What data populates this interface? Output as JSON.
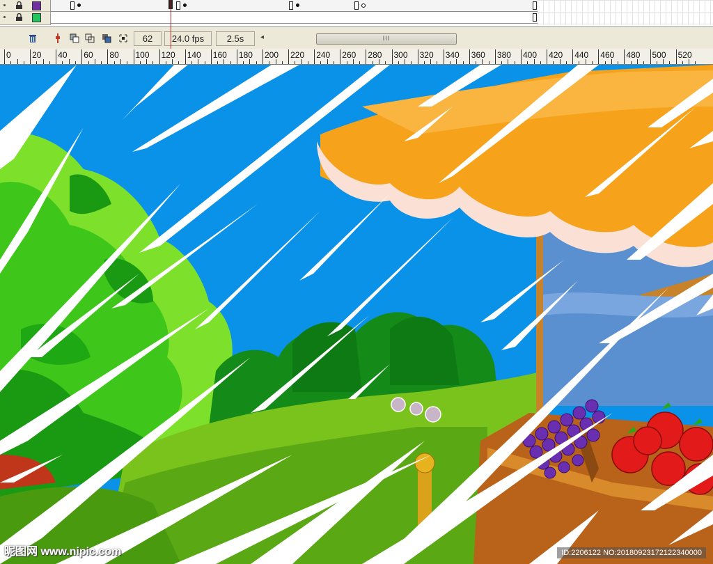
{
  "timeline": {
    "layers": [
      {
        "visibility_icon": "eye-dot-icon",
        "lock_icon": "lock-icon",
        "outline_color": "#7030a0"
      },
      {
        "visibility_icon": "eye-dot-icon",
        "lock_icon": "lock-icon",
        "outline_color": "#22c55e"
      }
    ]
  },
  "statusbar": {
    "icons": [
      "center-frame-icon",
      "onion-skin-icon",
      "onion-skin-outline-icon",
      "edit-multiple-frames-icon",
      "modify-markers-icon"
    ],
    "trash_icon": "trash-icon",
    "current_frame": "62",
    "frame_rate": "24.0 fps",
    "elapsed_time": "2.5s",
    "scroll_grip": "III"
  },
  "ruler": {
    "labels": [
      "0",
      "20",
      "40",
      "60",
      "80",
      "100",
      "120",
      "140",
      "160",
      "180",
      "200",
      "220",
      "240",
      "260",
      "280",
      "300",
      "320",
      "340",
      "360",
      "380",
      "400",
      "420",
      "440",
      "460",
      "480",
      "500",
      "520"
    ]
  },
  "watermark": {
    "left": "昵图网 www.nipic.com",
    "right": "ID:2206122 NO:20180923172122340000"
  },
  "colors": {
    "sky": "#0a92e8",
    "awning_orange": "#f7a21b",
    "awning_scallop": "#fbe0d6",
    "tree_green": "#39c21a",
    "grass": "#7ac21c",
    "apple_red": "#e21a1a",
    "grape_purple": "#6a2fb0",
    "crate_brown": "#b8621a"
  }
}
